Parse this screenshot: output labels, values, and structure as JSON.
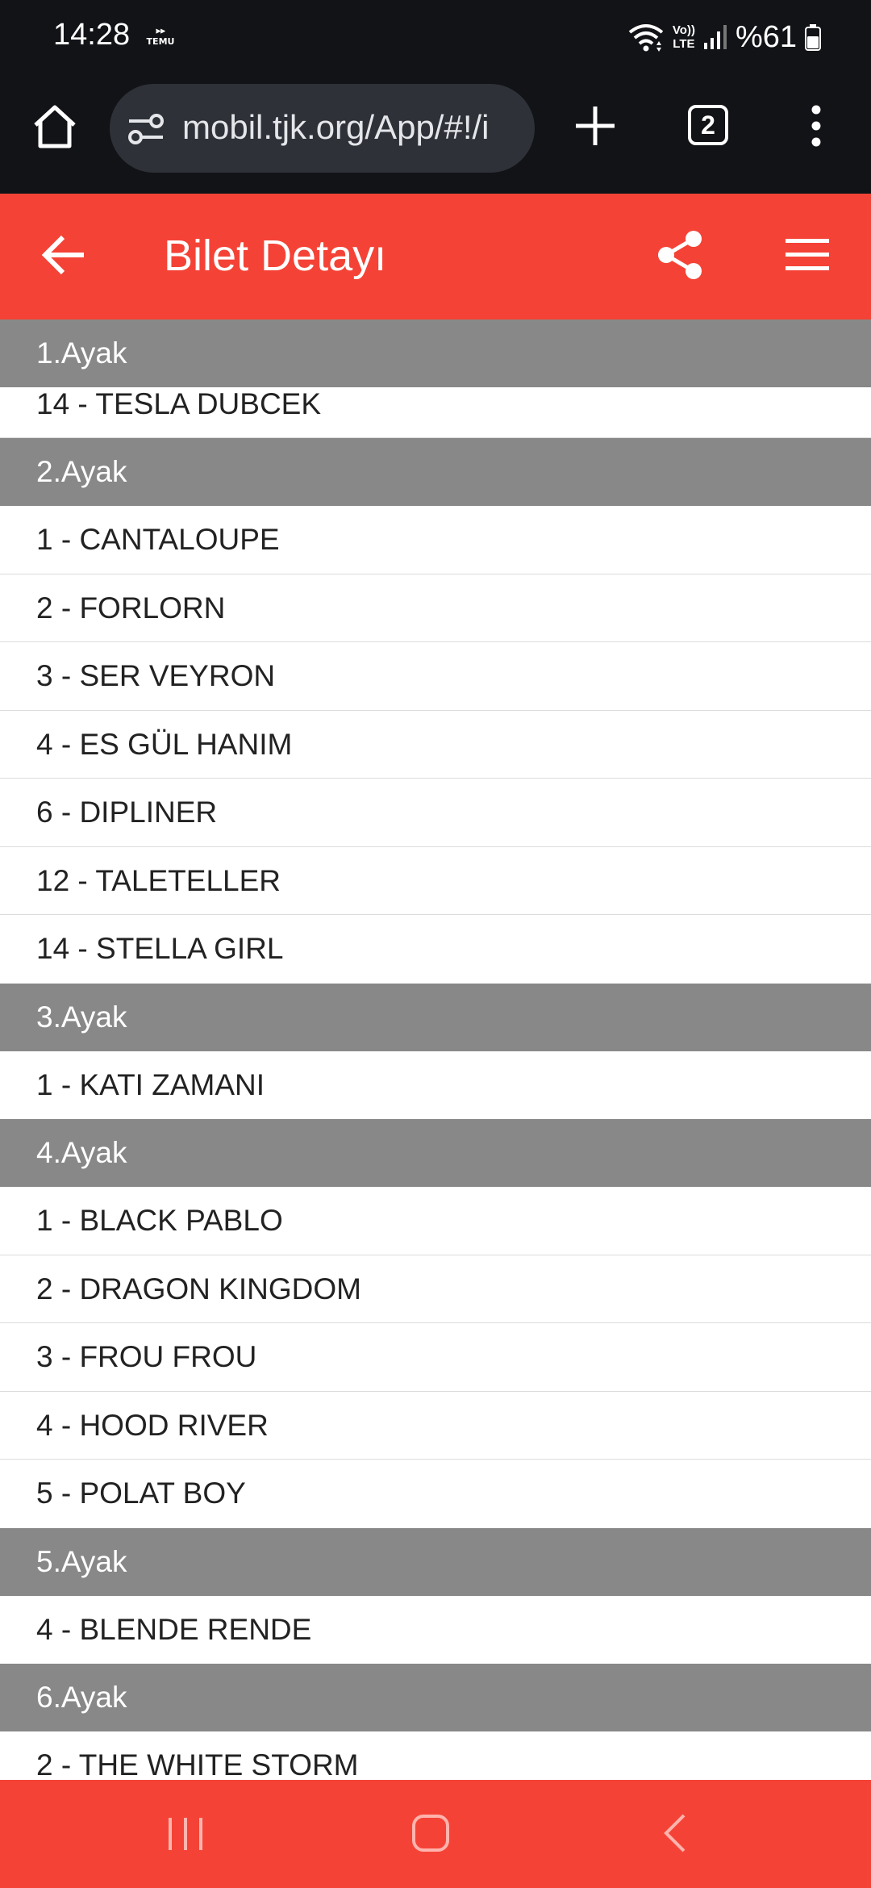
{
  "status_bar": {
    "time": "14:28",
    "temu_label": "TEMU",
    "battery": "%61",
    "volte_label": "Vo))",
    "lte_label": "LTE"
  },
  "browser": {
    "url": "mobil.tjk.org/App/#!/i",
    "tab_count": "2"
  },
  "app": {
    "title": "Bilet Detayı",
    "accent_color": "#f44336"
  },
  "legs": [
    {
      "title": "1.Ayak",
      "horses": [
        "14 - TESLA DUBCEK"
      ]
    },
    {
      "title": "2.Ayak",
      "horses": [
        "1 - CANTALOUPE",
        "2 - FORLORN",
        "3 - SER VEYRON",
        "4 - ES GÜL HANIM",
        "6 - DIPLINER",
        "12 - TALETELLER",
        "14 - STELLA GIRL"
      ]
    },
    {
      "title": "3.Ayak",
      "horses": [
        "1 - KATI ZAMANI"
      ]
    },
    {
      "title": "4.Ayak",
      "horses": [
        "1 - BLACK PABLO",
        "2 - DRAGON KINGDOM",
        "3 - FROU FROU",
        "4 - HOOD RIVER",
        "5 - POLAT BOY"
      ]
    },
    {
      "title": "5.Ayak",
      "horses": [
        "4 - BLENDE RENDE"
      ]
    },
    {
      "title": "6.Ayak",
      "horses": [
        "2 - THE WHITE STORM"
      ]
    }
  ],
  "icons": {
    "home": "home-icon",
    "tune": "tune-icon",
    "new_tab": "plus-icon",
    "tabs": "tab-switcher-icon",
    "more": "more-vert-icon",
    "back": "arrow-back-icon",
    "share": "share-icon",
    "menu": "hamburger-menu-icon",
    "nav_recents": "recents-icon",
    "nav_home": "nav-home-icon",
    "nav_back": "nav-back-icon"
  }
}
